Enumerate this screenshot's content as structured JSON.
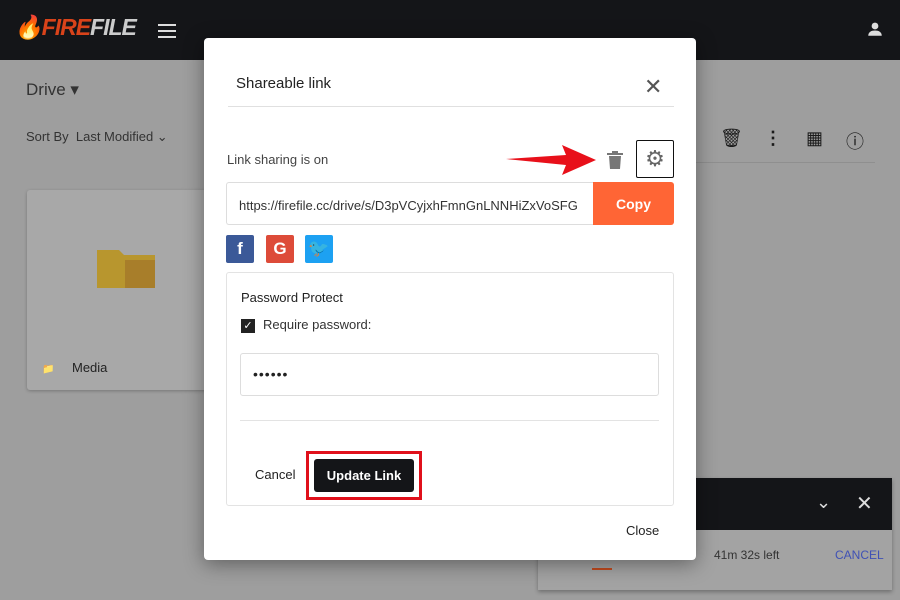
{
  "app": {
    "logo_fire": "FIRE",
    "logo_file": "FILE"
  },
  "drive": {
    "title": "Drive",
    "sort_label": "Sort By",
    "sort_value": "Last Modified",
    "folder_name": "Media"
  },
  "upload": {
    "time_left": "41m 32s left",
    "cancel": "CANCEL"
  },
  "modal": {
    "title": "Shareable link",
    "status": "Link sharing is on",
    "url": "https://firefile.cc/drive/s/D3pVCyjxhFmnGnLNNHiZxVoSFG",
    "copy": "Copy",
    "social": [
      {
        "name": "facebook",
        "glyph": "f",
        "color": "#3b5998"
      },
      {
        "name": "google",
        "glyph": "G",
        "color": "#dd4b39"
      },
      {
        "name": "twitter",
        "glyph": "t",
        "color": "#1da1f2"
      }
    ],
    "password_header": "Password Protect",
    "require_password": "Require password:",
    "require_checked": true,
    "password_value": "••••••",
    "cancel": "Cancel",
    "update": "Update Link",
    "close": "Close"
  },
  "colors": {
    "accent": "#ff6535",
    "highlight": "#e0101b",
    "dark": "#141518"
  }
}
